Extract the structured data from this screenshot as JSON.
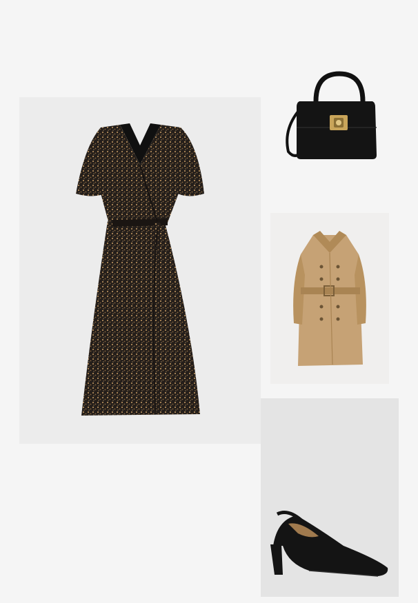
{
  "outfit": {
    "items": [
      {
        "kind": "dress",
        "icon": "dress-image"
      },
      {
        "kind": "handbag",
        "icon": "handbag-image"
      },
      {
        "kind": "trench-coat",
        "icon": "trench-coat-image"
      },
      {
        "kind": "slingback-heel",
        "icon": "shoe-image"
      }
    ]
  },
  "colors": {
    "background": "#f5f5f5",
    "dress_base": "#2a2420",
    "dress_print": "#b08a5a",
    "bag": "#111111",
    "hardware": "#c9a55a",
    "coat": "#c6a275",
    "shoe": "#141414"
  }
}
